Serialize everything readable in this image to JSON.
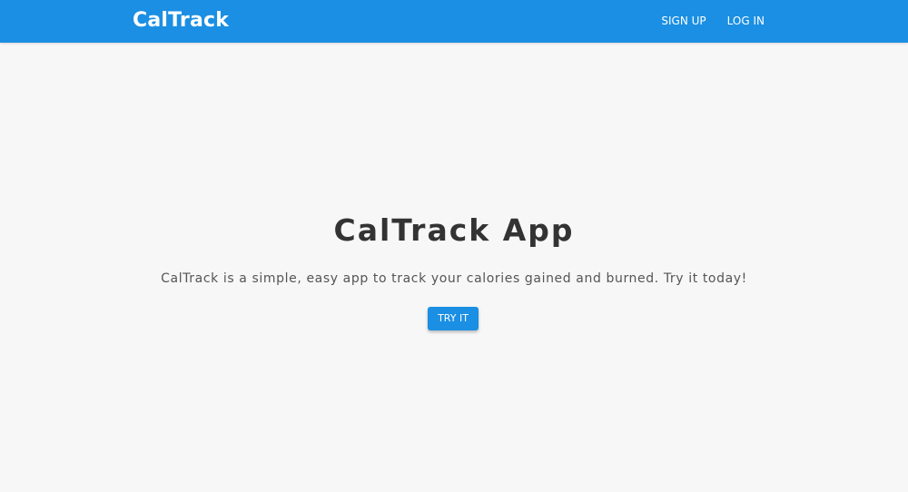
{
  "navbar": {
    "brand": "CalTrack",
    "links": [
      {
        "label": "SIGN UP"
      },
      {
        "label": "LOG IN"
      }
    ],
    "color": "#1a8fe3"
  },
  "hero": {
    "title": "CalTrack App",
    "description": "CalTrack is a simple, easy app to track your calories gained and burned. Try it today!",
    "button_label": "TRY IT",
    "background": "#f7f7f7"
  }
}
